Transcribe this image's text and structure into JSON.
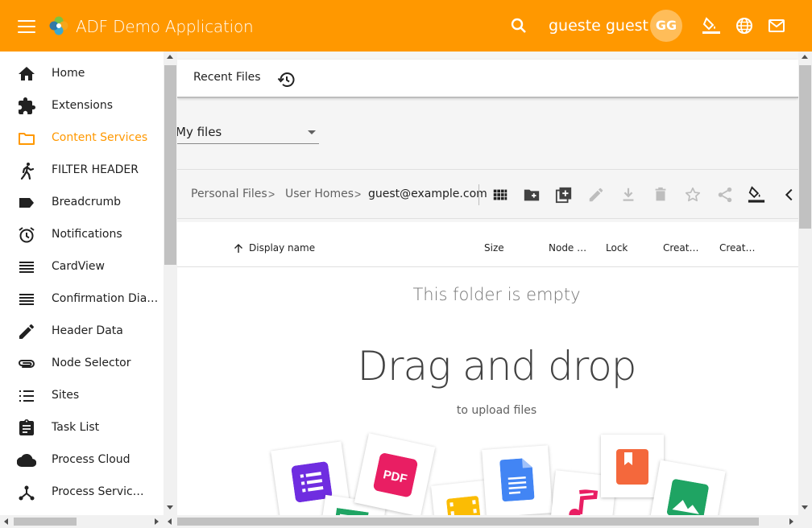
{
  "app": {
    "title": "ADF Demo Application",
    "user_name": "gueste guest",
    "avatar_initials": "GG",
    "accent_color": "#ff9800"
  },
  "header_icons": [
    "menu-icon",
    "search-icon",
    "theme-fill-icon",
    "language-globe-icon",
    "mail-icon"
  ],
  "sidebar": {
    "items": [
      {
        "label": "Home",
        "icon": "home-icon",
        "active": false
      },
      {
        "label": "Extensions",
        "icon": "extension-puzzle-icon",
        "active": false
      },
      {
        "label": "Content Services",
        "icon": "folder-icon",
        "active": true
      },
      {
        "label": "FILTER HEADER",
        "icon": "person-walking-icon",
        "active": false
      },
      {
        "label": "Breadcrumb",
        "icon": "label-icon",
        "active": false
      },
      {
        "label": "Notifications",
        "icon": "alarm-icon",
        "active": false
      },
      {
        "label": "CardView",
        "icon": "lines-icon",
        "active": false
      },
      {
        "label": "Confirmation Dia…",
        "icon": "lines-icon",
        "active": false
      },
      {
        "label": "Header Data",
        "icon": "pencil-icon",
        "active": false
      },
      {
        "label": "Node Selector",
        "icon": "attachment-icon",
        "active": false
      },
      {
        "label": "Sites",
        "icon": "list-icon",
        "active": false
      },
      {
        "label": "Task List",
        "icon": "assignment-icon",
        "active": false
      },
      {
        "label": "Process Cloud",
        "icon": "cloud-icon",
        "active": false
      },
      {
        "label": "Process Servic…",
        "icon": "device-hub-icon",
        "active": false
      }
    ]
  },
  "tabs": {
    "recent_label": "Recent Files",
    "recent_icon": "history-icon"
  },
  "source_select": {
    "value": "My files"
  },
  "breadcrumb": {
    "items": [
      "Personal Files",
      "User Homes",
      "guest@example.com"
    ],
    "separator": ">"
  },
  "toolbar_icons": [
    "grid-view-icon",
    "create-folder-icon",
    "upload-add-icon",
    "edit-icon",
    "download-icon",
    "delete-icon",
    "favorite-star-icon",
    "share-icon",
    "color-fill-icon",
    "collapse-chevron-icon"
  ],
  "columns": [
    "Display name",
    "Size",
    "Node …",
    "Lock",
    "Creat…",
    "Creat…"
  ],
  "empty_state": {
    "title": "This folder is empty",
    "headline": "Drag and drop",
    "subtitle": "to upload files"
  }
}
